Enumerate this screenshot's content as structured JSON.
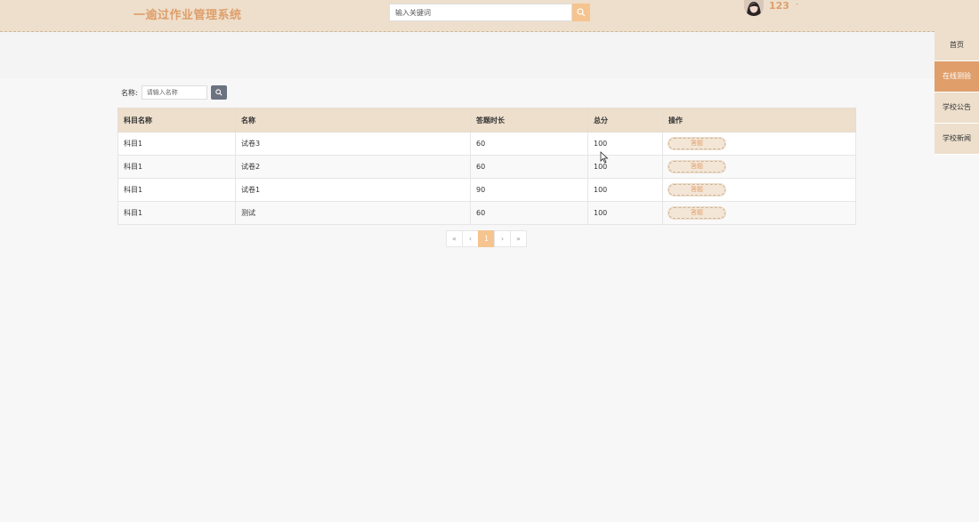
{
  "header": {
    "logo": "一逾过作业管理系统",
    "search_placeholder": "输入关键词",
    "username": "123",
    "user_caret": "-"
  },
  "sidenav": {
    "items": [
      {
        "label": "首页",
        "active": false
      },
      {
        "label": "在线测验",
        "active": true
      },
      {
        "label": "学校公告",
        "active": false
      },
      {
        "label": "学校新闻",
        "active": false
      }
    ]
  },
  "filter": {
    "label": "名称:",
    "placeholder": "请输入名称"
  },
  "table": {
    "columns": [
      "科目名称",
      "名称",
      "答题时长",
      "总分",
      "操作"
    ],
    "rows": [
      {
        "subject": "科目1",
        "name": "试卷3",
        "duration": "60",
        "score": "100",
        "action": "答题"
      },
      {
        "subject": "科目1",
        "name": "试卷2",
        "duration": "60",
        "score": "100",
        "action": "答题"
      },
      {
        "subject": "科目1",
        "name": "试卷1",
        "duration": "90",
        "score": "100",
        "action": "答题"
      },
      {
        "subject": "科目1",
        "name": "测试",
        "duration": "60",
        "score": "100",
        "action": "答题"
      }
    ]
  },
  "pagination": {
    "first": "«",
    "prev": "‹",
    "current": "1",
    "next": "›",
    "last": "»"
  },
  "icons": {
    "search": "search-icon",
    "avatar": "avatar",
    "cursor": "mouse-cursor-icon"
  },
  "colors": {
    "accent": "#df9e6a",
    "header_bg": "#eddfcc",
    "search_button": "#f6c48f"
  }
}
